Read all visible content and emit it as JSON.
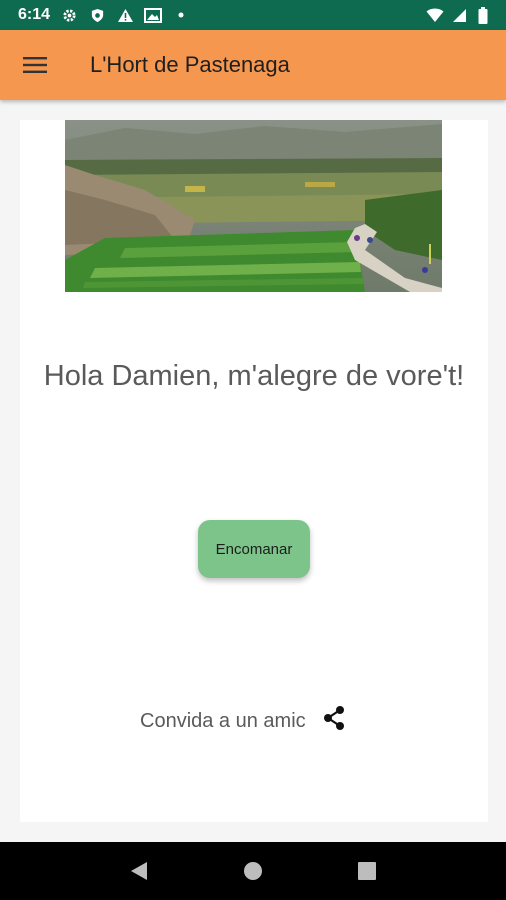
{
  "status_bar": {
    "time": "6:14",
    "icons": [
      "gear-icon",
      "shield-icon",
      "warning-icon",
      "image-icon",
      "dot-icon",
      "wifi-icon",
      "signal-icon",
      "battery-icon"
    ]
  },
  "app_bar": {
    "title": "L'Hort de Pastenaga",
    "menu_icon": "hamburger-menu-icon"
  },
  "main": {
    "greeting": "Hola Damien, m'alegre de vore't!",
    "order_button_label": "Encomanar",
    "invite_label": "Convida a un amic",
    "invite_icon": "share-icon"
  },
  "nav_bar": {
    "buttons": [
      "back-icon",
      "home-icon",
      "recents-icon"
    ]
  },
  "colors": {
    "status_bar": "#0f6b4f",
    "app_bar": "#f5974f",
    "order_button": "#7cc48a",
    "text_gray": "#5a5a5a"
  }
}
